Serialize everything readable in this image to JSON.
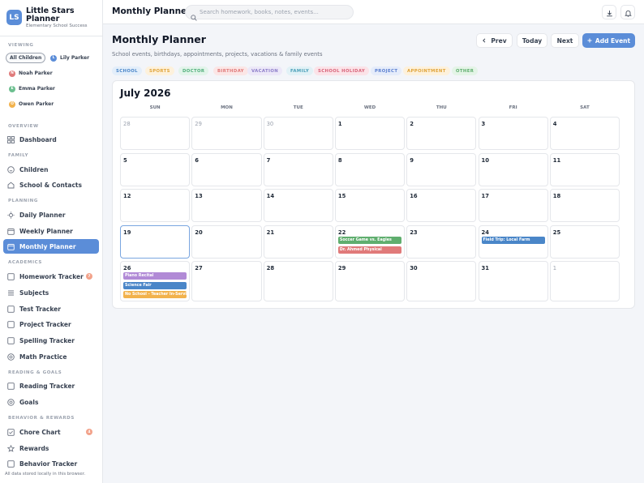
{
  "app": {
    "logo_initials": "LS",
    "name": "Little Stars Planner",
    "tagline": "Elementary School Success"
  },
  "viewing": {
    "label": "VIEWING",
    "chips": [
      {
        "label": "All Children",
        "initial": "",
        "color": "",
        "active": true
      },
      {
        "label": "Lily Parker",
        "initial": "L",
        "color": "#5b8dd8",
        "active": false
      },
      {
        "label": "Noah Parker",
        "initial": "N",
        "color": "#e07b7b",
        "active": false
      },
      {
        "label": "Emma Parker",
        "initial": "E",
        "color": "#6cbf8f",
        "active": false
      },
      {
        "label": "Owen Parker",
        "initial": "O",
        "color": "#f2b24c",
        "active": false
      }
    ]
  },
  "sections": {
    "overview": "OVERVIEW",
    "family": "FAMILY",
    "planning": "PLANNING",
    "academics": "ACADEMICS",
    "reading": "READING & GOALS",
    "behavior": "BEHAVIOR & REWARDS"
  },
  "nav": {
    "dashboard": "Dashboard",
    "children": "Children",
    "school_contacts": "School & Contacts",
    "daily": "Daily Planner",
    "weekly": "Weekly Planner",
    "monthly": "Monthly Planner",
    "homework": "Homework Tracker",
    "homework_badge": "7",
    "subjects": "Subjects",
    "test": "Test Tracker",
    "project": "Project Tracker",
    "spelling": "Spelling Tracker",
    "math": "Math Practice",
    "reading": "Reading Tracker",
    "goals": "Goals",
    "chore": "Chore Chart",
    "chore_badge": "4",
    "rewards": "Rewards",
    "behavior": "Behavior Tracker"
  },
  "footer_note": "All data stored locally in this browser.",
  "topbar": {
    "title": "Monthly Planner",
    "search_placeholder": "Search homework, books, notes, events..."
  },
  "page": {
    "title": "Monthly Planner",
    "subtitle": "School events, birthdays, appointments, projects, vacations & family events"
  },
  "toolbar": {
    "prev": "Prev",
    "today": "Today",
    "next": "Next",
    "add": "Add Event"
  },
  "legend": [
    {
      "label": "SCHOOL",
      "color": "#4a86c8",
      "bg": "#e3eefa"
    },
    {
      "label": "SPORTS",
      "color": "#e0a43a",
      "bg": "#fdf1dc"
    },
    {
      "label": "DOCTOR",
      "color": "#4fae7a",
      "bg": "#e2f4ea"
    },
    {
      "label": "BIRTHDAY",
      "color": "#e07a7a",
      "bg": "#fbe6e6"
    },
    {
      "label": "VACATION",
      "color": "#8d7ec9",
      "bg": "#ece8f8"
    },
    {
      "label": "FAMILY",
      "color": "#4a9fb8",
      "bg": "#e1f1f6"
    },
    {
      "label": "SCHOOL HOLIDAY",
      "color": "#d8647a",
      "bg": "#fbe3e8"
    },
    {
      "label": "PROJECT",
      "color": "#5a7fd0",
      "bg": "#e5ecfa"
    },
    {
      "label": "APPOINTMENT",
      "color": "#e0a43a",
      "bg": "#fdf1dc"
    },
    {
      "label": "OTHER",
      "color": "#5fae6e",
      "bg": "#e4f4e7"
    }
  ],
  "calendar": {
    "month_title": "July 2026",
    "weekdays": [
      "SUN",
      "MON",
      "TUE",
      "WED",
      "THU",
      "FRI",
      "SAT"
    ],
    "weeks": [
      [
        {
          "d": "28",
          "out": true
        },
        {
          "d": "29",
          "out": true
        },
        {
          "d": "30",
          "out": true
        },
        {
          "d": "1"
        },
        {
          "d": "2"
        },
        {
          "d": "3"
        },
        {
          "d": "4"
        }
      ],
      [
        {
          "d": "5"
        },
        {
          "d": "6"
        },
        {
          "d": "7"
        },
        {
          "d": "8"
        },
        {
          "d": "9"
        },
        {
          "d": "10"
        },
        {
          "d": "11"
        }
      ],
      [
        {
          "d": "12"
        },
        {
          "d": "13"
        },
        {
          "d": "14"
        },
        {
          "d": "15"
        },
        {
          "d": "16"
        },
        {
          "d": "17"
        },
        {
          "d": "18"
        }
      ],
      [
        {
          "d": "19",
          "today": true
        },
        {
          "d": "20"
        },
        {
          "d": "21"
        },
        {
          "d": "22",
          "events": [
            {
              "title": "Soccer Game vs. Eagles",
              "color": "#5fae6e"
            },
            {
              "title": "Dr. Ahmed Physical",
              "color": "#e07a7a"
            }
          ]
        },
        {
          "d": "23"
        },
        {
          "d": "24",
          "events": [
            {
              "title": "Field Trip: Local Farm",
              "color": "#4a86c8"
            }
          ]
        },
        {
          "d": "25"
        }
      ],
      [
        {
          "d": "26",
          "events": [
            {
              "title": "Piano Recital",
              "color": "#b18ad6"
            },
            {
              "title": "Science Fair",
              "color": "#4a86c8"
            },
            {
              "title": "No School - Teacher In-Service",
              "color": "#f2b24c"
            }
          ]
        },
        {
          "d": "27"
        },
        {
          "d": "28"
        },
        {
          "d": "29"
        },
        {
          "d": "30"
        },
        {
          "d": "31"
        },
        {
          "d": "1",
          "out": true
        }
      ]
    ]
  }
}
